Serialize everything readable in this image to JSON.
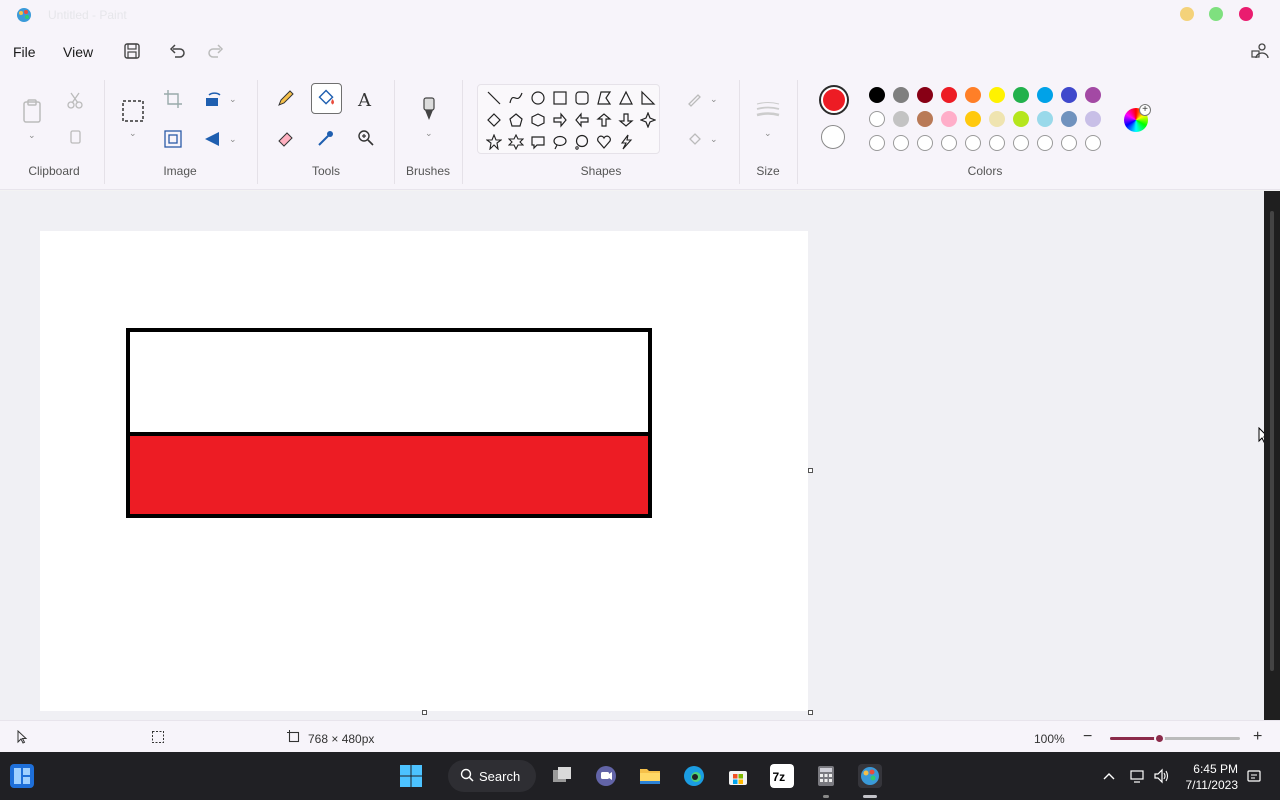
{
  "window": {
    "title": "Untitled - Paint"
  },
  "menu": {
    "file": "File",
    "view": "View"
  },
  "ribbon": {
    "groups": {
      "clipboard": "Clipboard",
      "image": "Image",
      "tools": "Tools",
      "brushes": "Brushes",
      "shapes": "Shapes",
      "size": "Size",
      "colors": "Colors"
    },
    "primary_color": "#ed1c24",
    "secondary_color": "#ffffff",
    "palette_row1": [
      "#000000",
      "#7f7f7f",
      "#880015",
      "#ed1c24",
      "#ff7f27",
      "#fff200",
      "#22b14c",
      "#00a2e8",
      "#3f48cc",
      "#a349a4"
    ],
    "palette_row2": [
      "#ffffff",
      "#c3c3c3",
      "#b97a57",
      "#ffaec9",
      "#ffc90e",
      "#efe4b0",
      "#b5e61d",
      "#99d9ea",
      "#7092be",
      "#c8bfe7"
    ]
  },
  "canvas": {
    "stripes": [
      {
        "name": "white",
        "color": "#ffffff"
      },
      {
        "name": "red",
        "color": "#ed1c24"
      }
    ]
  },
  "status": {
    "canvas_size": "768 × 480px",
    "zoom": "100%",
    "zoom_level": 0.38
  },
  "taskbar": {
    "search_label": "Search",
    "time": "6:45 PM",
    "date": "7/11/2023"
  }
}
